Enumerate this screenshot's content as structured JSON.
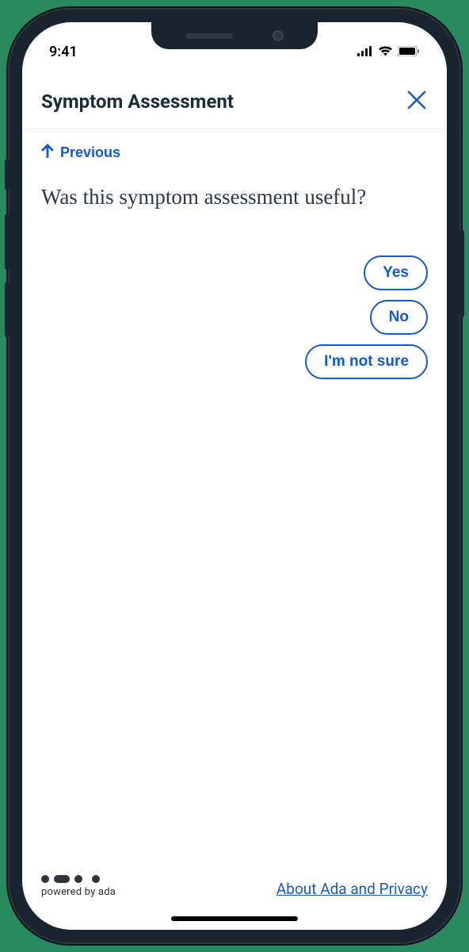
{
  "status_bar": {
    "time": "9:41"
  },
  "header": {
    "title": "Symptom Assessment"
  },
  "nav": {
    "previous_label": "Previous"
  },
  "question": {
    "text": "Was this symptom assessment useful?",
    "options": [
      "Yes",
      "No",
      "I'm not sure"
    ]
  },
  "footer": {
    "powered_text": "powered by ada",
    "privacy_link": "About Ada and Privacy"
  },
  "colors": {
    "accent": "#1559cf"
  }
}
